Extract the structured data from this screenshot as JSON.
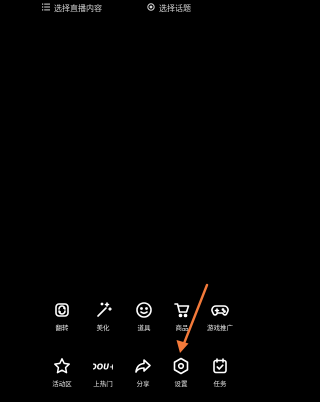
{
  "top_bar": {
    "content_label": "选择直播内容",
    "topic_label": "选择话题"
  },
  "toolbar_row1": [
    {
      "label": "翻转",
      "icon": "flip-icon"
    },
    {
      "label": "美化",
      "icon": "beautify-wand-icon"
    },
    {
      "label": "道具",
      "icon": "smiley-icon"
    },
    {
      "label": "商品",
      "icon": "shopping-cart-icon"
    },
    {
      "label": "游戏推广",
      "icon": "gamepad-icon"
    }
  ],
  "toolbar_row2": [
    {
      "label": "活动区",
      "icon": "star-icon"
    },
    {
      "label": "上热门",
      "icon": "dou-plus-icon",
      "icon_text": "DOU+"
    },
    {
      "label": "分享",
      "icon": "share-arrow-icon"
    },
    {
      "label": "设置",
      "icon": "hexagon-settings-icon"
    },
    {
      "label": "任务",
      "icon": "calendar-check-icon"
    }
  ],
  "annotation": {
    "arrow_color": "#f47a3a"
  }
}
